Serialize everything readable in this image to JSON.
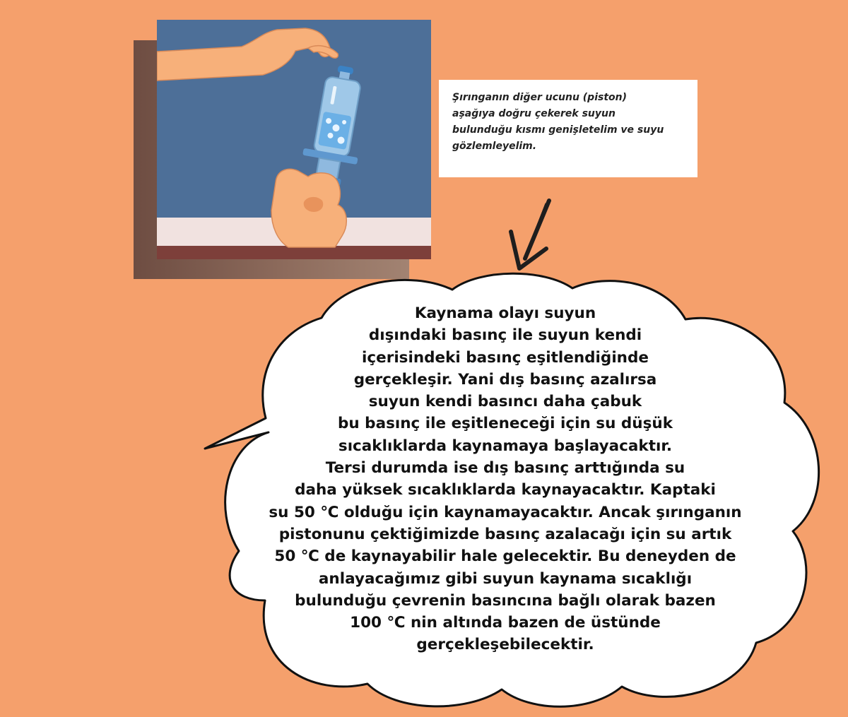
{
  "caption": {
    "text": "Şırınganın diğer ucunu (piston)\naşağıya doğru çekerek suyun\nbulunduğu kısmı genişletelim ve suyu\ngözlemleyelim."
  },
  "explanation": {
    "text": "Kaynama olayı suyun\ndışındaki basınç ile suyun kendi\niçerisindeki basınç eşitlendiğinde\ngerçekleşir. Yani dış basınç azalırsa\nsuyun kendi basıncı daha çabuk\nbu basınç ile eşitleneceği için su düşük\nsıcaklıklarda kaynamaya başlayacaktır.\nTersi durumda ise dış basınç arttığında su\ndaha yüksek sıcaklıklarda kaynayacaktır. Kaptaki\nsu 50 ℃ olduğu için kaynamayacaktır. Ancak şırınganın\npistonunu çektiğimizde basınç azalacağı için su artık\n50 ℃ de kaynayabilir hale gelecektir. Bu deneyden de\nanlayacağımız gibi suyun kaynama sıcaklığı\nbulunduğu çevrenin basıncına bağlı olarak bazen\n100 ℃ nin altında bazen de üstünde\ngerçekleşebilecektir."
  },
  "colors": {
    "page_background": "#f5a06c",
    "illustration_wall": "#4d6f98",
    "illustration_table": "#f1e2e0",
    "illustration_table_edge": "#7d3f3a",
    "skin": "#f7b07a",
    "syringe": "#9fc8e8",
    "speech_bubble": "#ffffff"
  },
  "icons": {
    "pointer": "hand-drawn-arrow-icon"
  }
}
